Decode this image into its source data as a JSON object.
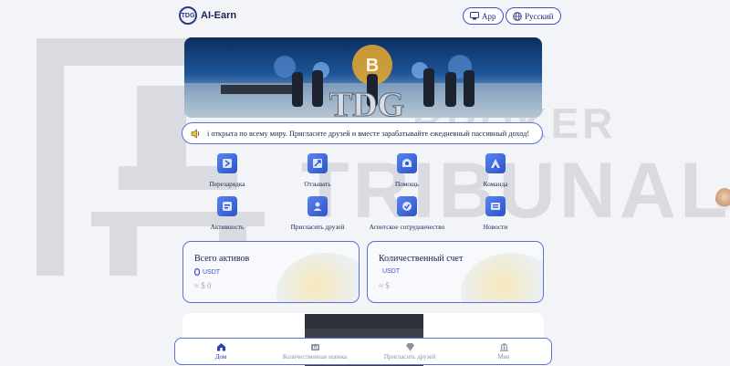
{
  "app": {
    "name": "AI-Earn",
    "logo_mark": "TDG"
  },
  "header": {
    "app_button": {
      "label": "App",
      "icon": "monitor-icon"
    },
    "lang_button": {
      "label": "Русский",
      "icon": "globe-icon"
    }
  },
  "banner": {
    "text": "TDG"
  },
  "notice": {
    "icon": "speaker-icon",
    "text": "і открыта по всему миру. Пригласите друзей и вместе зарабатывайте ежедневный пассивный доход!"
  },
  "menu": {
    "items": [
      {
        "label": "Перезарядка",
        "icon": "recharge-icon"
      },
      {
        "label": "Отзывать",
        "icon": "withdraw-icon"
      },
      {
        "label": "Помощь",
        "icon": "help-icon"
      },
      {
        "label": "Команда",
        "icon": "team-icon"
      },
      {
        "label": "Активность",
        "icon": "activity-icon"
      },
      {
        "label": "Пригласить друзей",
        "icon": "invite-icon"
      },
      {
        "label": "Агентское сотрудничество",
        "icon": "agent-icon"
      },
      {
        "label": "Новости",
        "icon": "news-icon"
      }
    ]
  },
  "cards": {
    "total_assets": {
      "title": "Всего активов",
      "unit": "USDT",
      "amount": "≈ $ 0"
    },
    "quant_account": {
      "title": "Количественный счет",
      "unit": "USDT",
      "amount": "≈ $"
    }
  },
  "watermark": {
    "line1": "BROKER",
    "line2": "TRIBUNAL"
  },
  "bottom_nav": {
    "items": [
      {
        "label": "Дом",
        "icon": "home-icon",
        "active": true
      },
      {
        "label": "Количественная оценка",
        "icon": "chart-icon",
        "active": false
      },
      {
        "label": "Пригласить друзей",
        "icon": "diamond-icon",
        "active": false
      },
      {
        "label": "Мне",
        "icon": "bank-icon",
        "active": false
      }
    ]
  },
  "colors": {
    "accent": "#3b50c8",
    "text": "#1b2150",
    "muted": "#8c90a0",
    "background": "#f3f4f8"
  }
}
